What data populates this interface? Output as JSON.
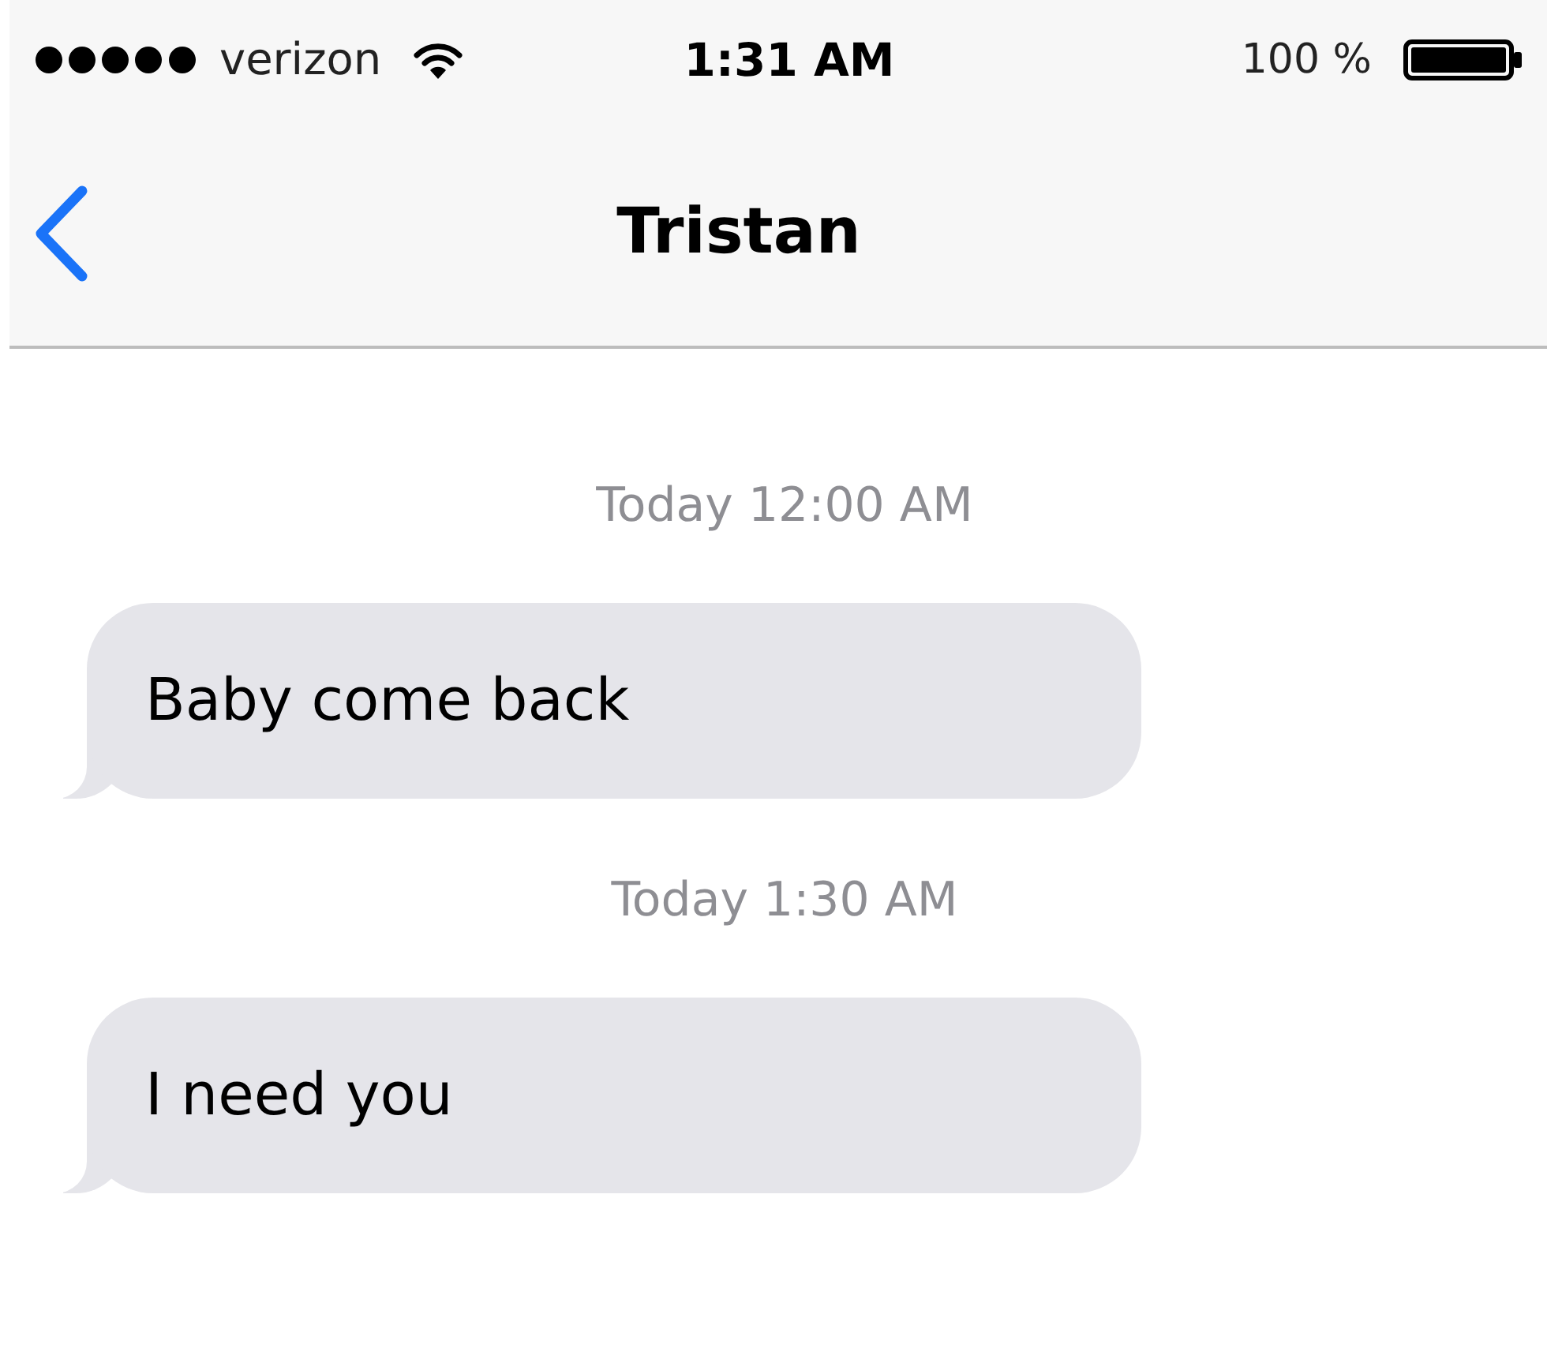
{
  "status_bar": {
    "carrier": "verizon",
    "time": "1:31 AM",
    "battery": "100 %"
  },
  "nav_bar": {
    "title": "Tristan"
  },
  "thread": [
    {
      "kind": "timestamp",
      "text": "Today 12:00 AM"
    },
    {
      "kind": "incoming",
      "text": "Baby come back"
    },
    {
      "kind": "timestamp",
      "text": "Today 1:30 AM"
    },
    {
      "kind": "incoming",
      "text": "I need you"
    }
  ]
}
